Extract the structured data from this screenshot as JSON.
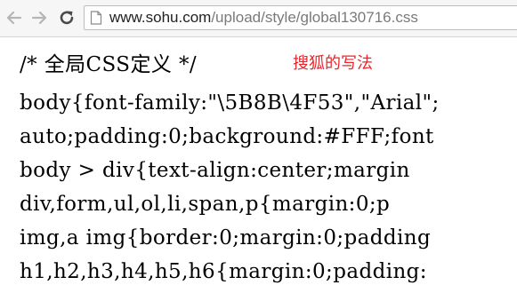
{
  "browser": {
    "back_icon": "arrow-left-icon",
    "forward_icon": "arrow-right-icon",
    "reload_icon": "reload-icon",
    "page_icon": "page-icon",
    "url_host": "www.sohu.com",
    "url_path": "/upload/style/global130716.css",
    "colors": {
      "toolbar": "#f6f6f6",
      "url_host": "#222222",
      "url_path": "#7a7a7a"
    }
  },
  "annotation": {
    "text": "搜狐的写法",
    "color": "#e8262c"
  },
  "css_source": {
    "lines": [
      "/* 全局CSS定义 */",
      "body{font-family:\"\\5B8B\\4F53\",\"Arial\";",
      "auto;padding:0;background:#FFF;font",
      "body > div{text-align:center;margin",
      "div,form,ul,ol,li,span,p{margin:0;p",
      "img,a img{border:0;margin:0;padding",
      "h1,h2,h3,h4,h5,h6{margin:0;padding:"
    ]
  }
}
